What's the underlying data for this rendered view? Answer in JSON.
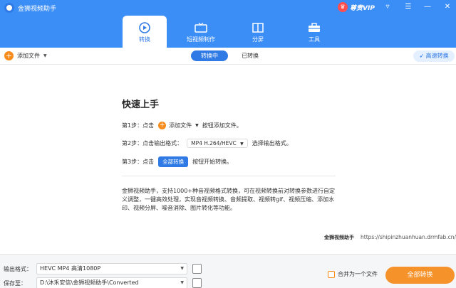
{
  "app": {
    "title": "金狮视频助手"
  },
  "vip": {
    "label": "尊贵VIP"
  },
  "window_controls": {
    "dropdown": "▿",
    "menu": "☰",
    "minimize": "—",
    "close": "✕"
  },
  "tabs": [
    {
      "label": "转换",
      "icon": "convert-icon"
    },
    {
      "label": "短视频制作",
      "icon": "tv-icon"
    },
    {
      "label": "分屏",
      "icon": "split-screen-icon"
    },
    {
      "label": "工具",
      "icon": "toolbox-icon"
    }
  ],
  "subbar": {
    "add_file": "添加文件",
    "status_tabs": [
      "转换中",
      "已转换"
    ],
    "speed": "高速转换"
  },
  "guide": {
    "title": "快速上手",
    "step1": {
      "prefix": "第1步：点击",
      "button": "添加文件",
      "suffix": "按钮添加文件。"
    },
    "step2": {
      "prefix": "第2步：点击输出格式：",
      "format": "MP4 H.264/HEVC",
      "suffix": "选择输出格式。"
    },
    "step3": {
      "prefix": "第3步：点击",
      "button": "全部转换",
      "suffix": "按钮开始转换。"
    },
    "description": "金狮视频助手，支持1000+种音视频格式转换，可在视频转换前对转换参数进行自定义调整，一键高效处理，实现音视频转换、音频提取、视频转gif、视频压缩、添加水印、视频分屏、噪音消除、图片转化等功能。",
    "brand": "金狮视频助手",
    "url": "https://shipinzhuanhuan.drmfab.cn/"
  },
  "bottom": {
    "format_label": "输出格式：",
    "format_value": "HEVC MP4 高清1080P",
    "save_label": "保存至：",
    "save_path": "D:\\沐禾安信\\金狮视频助手\\Converted",
    "merge_label": "合并为一个文件",
    "convert_all": "全部转换"
  },
  "colors": {
    "primary": "#3c8ef7",
    "accent": "#f6922a"
  }
}
